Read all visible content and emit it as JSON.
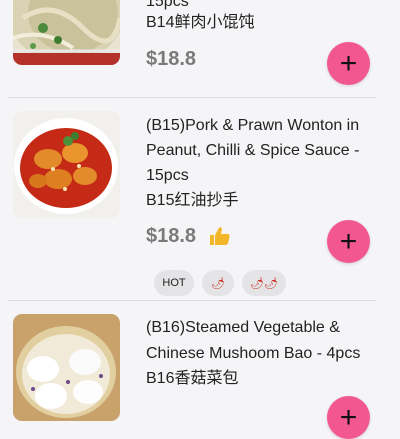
{
  "items": [
    {
      "title_lines": [
        "15pcs"
      ],
      "chinese": "B14鲜肉小馄饨",
      "price": "$18.8"
    },
    {
      "title_lines": [
        "(B15)Pork & Prawn Wonton in",
        "Peanut, Chilli & Spice Sauce -",
        "15pcs"
      ],
      "chinese": "B15红油抄手",
      "price": "$18.8",
      "tags": [
        "HOT",
        "🌶",
        "🌶🌶"
      ]
    },
    {
      "title_lines": [
        "(B16)Steamed Vegetable &",
        "Chinese Mushoom Bao - 4pcs"
      ],
      "chinese": "B16香菇菜包"
    }
  ],
  "add_button_label": "+",
  "colors": {
    "accent": "#f2578f",
    "price": "#7a7a7a",
    "tag_bg": "#e4e4e6"
  },
  "icons": {
    "recommend": "thumbs-up-icon",
    "add": "plus-icon"
  }
}
